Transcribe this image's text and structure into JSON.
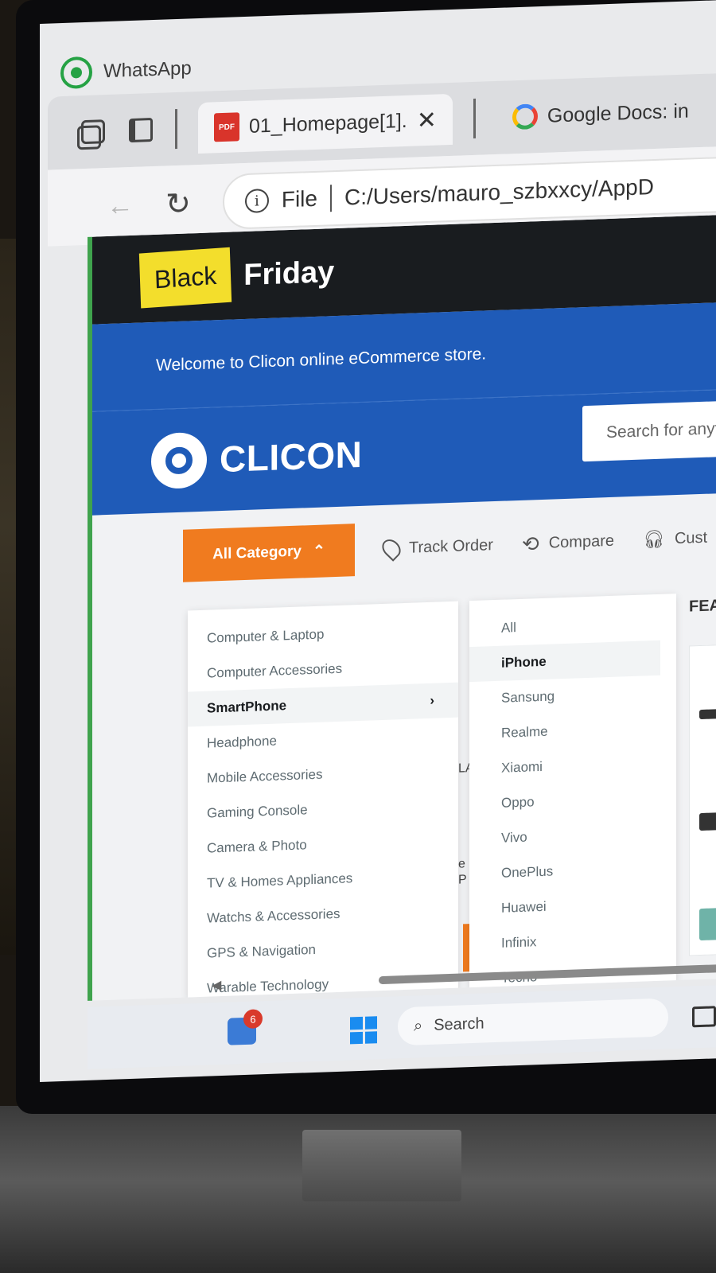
{
  "browser": {
    "pinned_app": "WhatsApp",
    "tabs": [
      {
        "title": "01_Homepage[1].",
        "icon": "pdf-icon",
        "active": true
      },
      {
        "title": "Google Docs: in",
        "icon": "google-icon",
        "active": false
      }
    ],
    "address": {
      "scheme_label": "File",
      "url": "C:/Users/mauro_szbxxcy/AppD"
    }
  },
  "page": {
    "promo": {
      "tag": "Black",
      "text": "Friday"
    },
    "welcome": "Welcome to Clicon online eCommerce store.",
    "brand": "CLICON",
    "search_placeholder": "Search for anyt",
    "nav": {
      "all_category": "All Category",
      "track_order": "Track Order",
      "compare": "Compare",
      "customer": "Cust"
    },
    "categories": [
      {
        "label": "Computer & Laptop"
      },
      {
        "label": "Computer Accessories"
      },
      {
        "label": "SmartPhone",
        "active": true
      },
      {
        "label": "Headphone"
      },
      {
        "label": "Mobile Accessories"
      },
      {
        "label": "Gaming Console"
      },
      {
        "label": "Camera & Photo"
      },
      {
        "label": "TV & Homes Appliances"
      },
      {
        "label": "Watchs & Accessories"
      },
      {
        "label": "GPS & Navigation"
      },
      {
        "label": "Warable Technology"
      }
    ],
    "brands": [
      {
        "label": "All"
      },
      {
        "label": "iPhone",
        "active": true
      },
      {
        "label": "Sansung"
      },
      {
        "label": "Realme"
      },
      {
        "label": "Xiaomi"
      },
      {
        "label": "Oppo"
      },
      {
        "label": "Vivo"
      },
      {
        "label": "OnePlus"
      },
      {
        "label": "Huawei"
      },
      {
        "label": "Infinix"
      },
      {
        "label": "Tecno"
      }
    ],
    "featured_heading": "FEA",
    "behind_fragments": [
      "LA",
      "e",
      "P"
    ]
  },
  "taskbar": {
    "badge_count": "6",
    "search_label": "Search"
  },
  "colors": {
    "promo_yellow": "#f3de2c",
    "header_blue": "#1f5bb8",
    "accent_orange": "#f07b1f",
    "dark": "#191c1f"
  }
}
